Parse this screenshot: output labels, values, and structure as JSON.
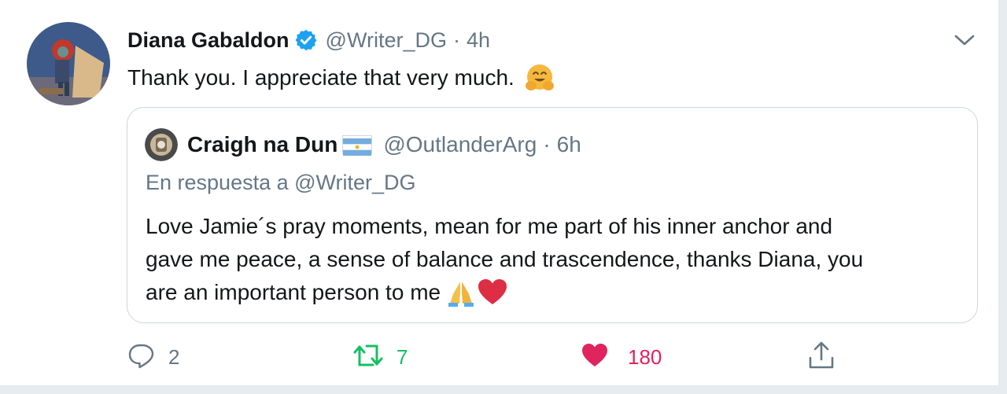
{
  "tweet": {
    "author_name": "Diana Gabaldon",
    "author_handle": "@Writer_DG",
    "separator": "·",
    "time": "4h",
    "text": "Thank you.  I appreciate that very much.",
    "text_emoji": "hugging-face-emoji",
    "verified": true
  },
  "quoted": {
    "author_name": "Craigh na Dun",
    "author_flag": "argentina-flag",
    "author_handle": "@OutlanderArg",
    "separator": "·",
    "time": "6h",
    "reply_to": "En respuesta a @Writer_DG",
    "text_lines": [
      "Love Jamie´s pray moments, mean for me part of his inner anchor and",
      "gave me peace, a sense of balance and trascendence,  thanks Diana, you",
      "are an important person to me"
    ],
    "text_emojis": [
      "folded-hands-emoji",
      "red-heart-emoji"
    ]
  },
  "actions": {
    "reply_count": "2",
    "retweet_count": "7",
    "like_count": "180"
  },
  "colors": {
    "brand": "#1da1f2",
    "secondary_text": "#657786",
    "retweet_green": "#17bf63",
    "like_red": "#e0245e"
  }
}
